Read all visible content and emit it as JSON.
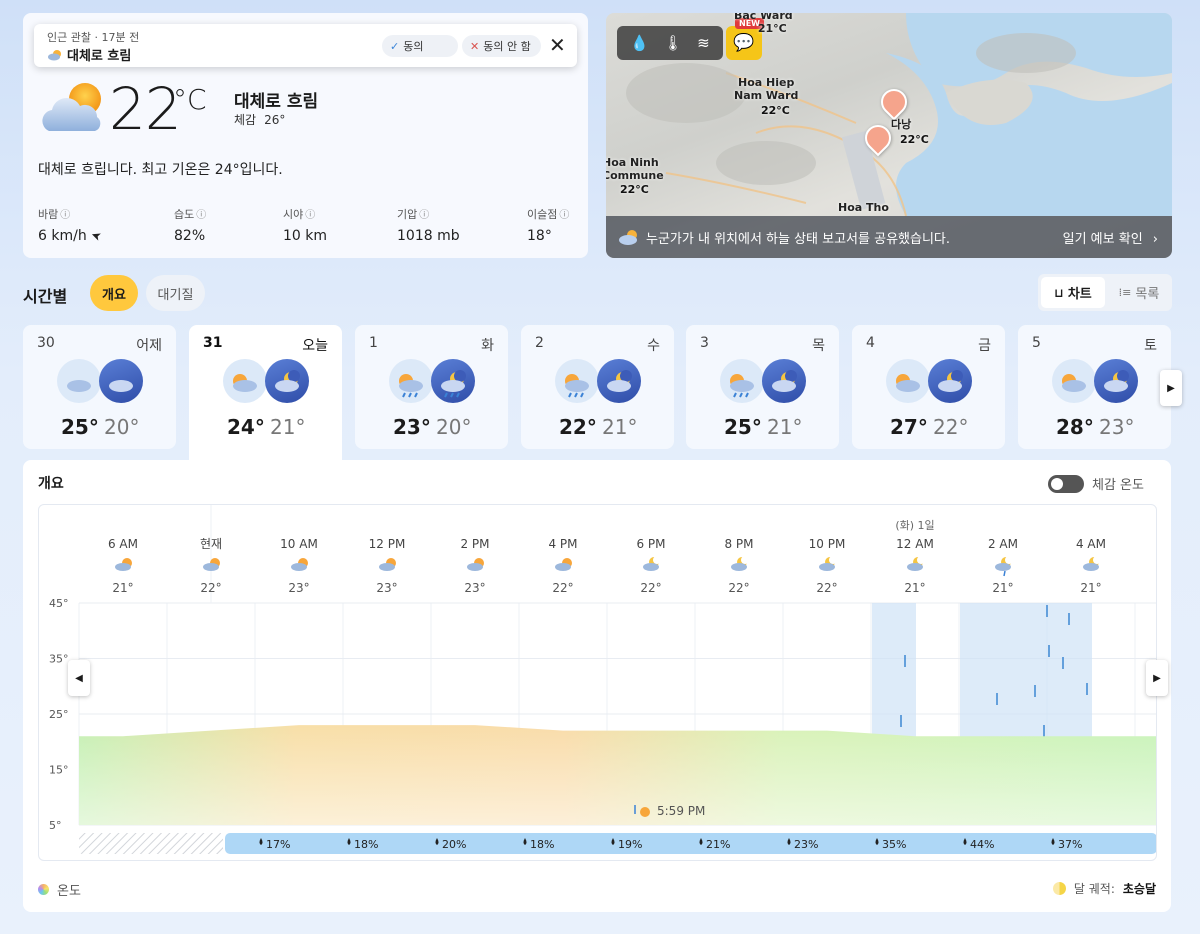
{
  "current": {
    "observation": {
      "meta": "인근 관찰 · 17분 전",
      "label": "대체로 흐림",
      "agree": "동의",
      "disagree": "동의 안 함"
    },
    "temperature": "22",
    "unit": "°C",
    "condition": "대체로 흐림",
    "feels_label": "체감",
    "feels_value": "26°",
    "summary": "대체로 흐립니다. 최고 기온은 24°입니다.",
    "stats": [
      {
        "label": "바람",
        "value": "6 km/h"
      },
      {
        "label": "습도",
        "value": "82%"
      },
      {
        "label": "시야",
        "value": "10 km"
      },
      {
        "label": "기압",
        "value": "1018 mb"
      },
      {
        "label": "이슬점",
        "value": "18°"
      }
    ]
  },
  "map": {
    "new_badge": "NEW",
    "labels": [
      {
        "name": "Bac Ward",
        "temp": "21°C"
      },
      {
        "name": "Hoa Hiep\nNam Ward",
        "temp": "22°C"
      },
      {
        "name": "다낭",
        "temp": "22°C"
      },
      {
        "name": "Hoa Ninh\nCommune",
        "temp": "22°C"
      },
      {
        "name": "Hoa Tho",
        "temp": ""
      }
    ],
    "footer_message": "누군가가 내 위치에서 하늘 상태 보고서를 공유했습니다.",
    "footer_link": "일기 예보 확인"
  },
  "hourly_section": {
    "title": "시간별",
    "tab_overview": "개요",
    "tab_air": "대기질",
    "view_chart": "차트",
    "view_list": "목록"
  },
  "days": [
    {
      "date": "30",
      "weekday": "어제",
      "high": "25°",
      "low": "20°",
      "active": false
    },
    {
      "date": "31",
      "weekday": "오늘",
      "high": "24°",
      "low": "21°",
      "active": true
    },
    {
      "date": "1",
      "weekday": "화",
      "high": "23°",
      "low": "20°",
      "active": false
    },
    {
      "date": "2",
      "weekday": "수",
      "high": "22°",
      "low": "21°",
      "active": false
    },
    {
      "date": "3",
      "weekday": "목",
      "high": "25°",
      "low": "21°",
      "active": false
    },
    {
      "date": "4",
      "weekday": "금",
      "high": "27°",
      "low": "22°",
      "active": false
    },
    {
      "date": "5",
      "weekday": "토",
      "high": "28°",
      "low": "23°",
      "active": false
    }
  ],
  "chart_card": {
    "title": "개요",
    "feels_toggle": "체감 온도",
    "legend_temp": "온도",
    "legend_moon_label": "달 궤적:",
    "legend_moon_value": "초승달",
    "sunset_label": "5:59 PM"
  },
  "chart_data": {
    "type": "area",
    "x": [
      "6 AM",
      "현재",
      "10 AM",
      "12 PM",
      "2 PM",
      "4 PM",
      "6 PM",
      "8 PM",
      "10 PM",
      "12 AM",
      "2 AM",
      "4 AM"
    ],
    "day_marker": {
      "index": 9,
      "label": "(화) 1일"
    },
    "temperature": [
      21,
      22,
      23,
      23,
      23,
      22,
      22,
      22,
      22,
      21,
      21,
      21
    ],
    "temperature_labels": [
      "21°",
      "22°",
      "23°",
      "23°",
      "23°",
      "22°",
      "22°",
      "22°",
      "22°",
      "21°",
      "21°",
      "21°"
    ],
    "precipitation_probability": [
      "17%",
      "18%",
      "20%",
      "18%",
      "19%",
      "21%",
      "23%",
      "35%",
      "44%",
      "37%"
    ],
    "y_ticks": [
      "45°",
      "35°",
      "25°",
      "15°",
      "5°"
    ],
    "ylim": [
      5,
      45
    ],
    "grid": true
  }
}
